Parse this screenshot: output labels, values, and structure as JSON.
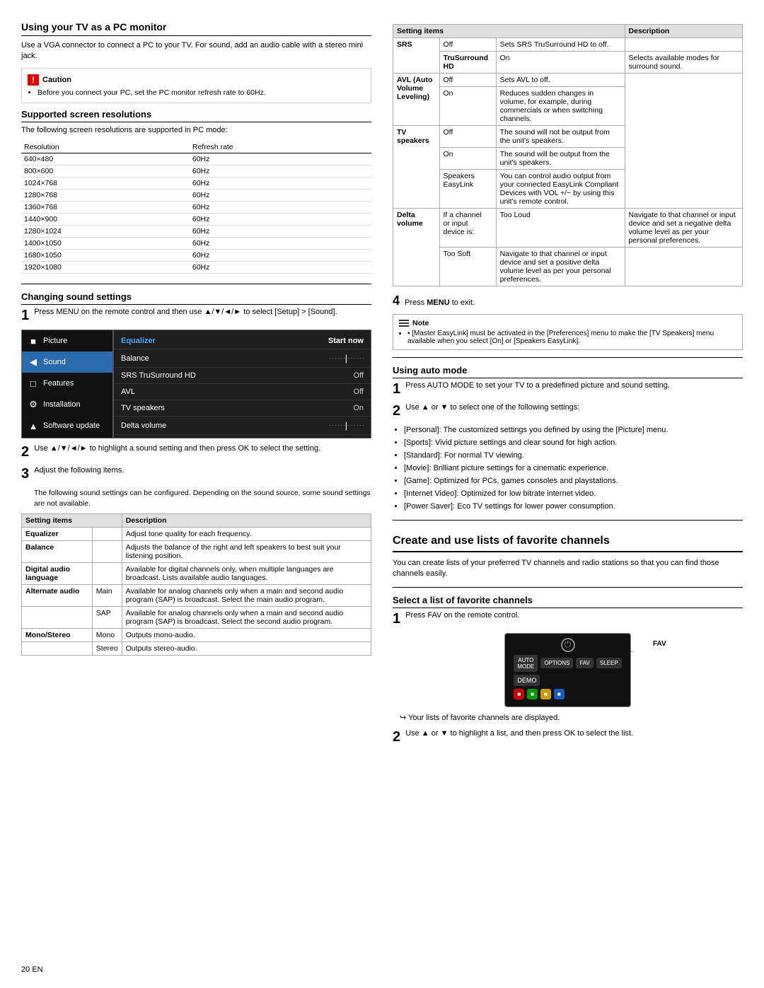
{
  "page": {
    "number": "20",
    "language": "EN"
  },
  "left": {
    "pc_monitor": {
      "title": "Using your TV as a PC monitor",
      "description": "Use a VGA connector to connect a PC to your TV. For sound, add an audio cable with a stereo mini jack.",
      "caution": {
        "label": "Caution",
        "items": [
          "Before you connect your PC, set the PC monitor refresh rate to 60Hz."
        ]
      },
      "screen_resolutions": {
        "title": "Supported screen resolutions",
        "description": "The following screen resolutions are supported in PC mode:",
        "columns": [
          "Resolution",
          "Refresh rate"
        ],
        "rows": [
          [
            "640×480",
            "60Hz"
          ],
          [
            "800×600",
            "60Hz"
          ],
          [
            "1024×768",
            "60Hz"
          ],
          [
            "1280×768",
            "60Hz"
          ],
          [
            "1360×768",
            "60Hz"
          ],
          [
            "1440×900",
            "60Hz"
          ],
          [
            "1280×1024",
            "60Hz"
          ],
          [
            "1400×1050",
            "60Hz"
          ],
          [
            "1680×1050",
            "60Hz"
          ],
          [
            "1920×1080",
            "60Hz"
          ]
        ]
      }
    },
    "sound_settings": {
      "title": "Changing sound settings",
      "step1_text": "Press MENU on the remote control and then use ▲/▼/◄/► to select [Setup] > [Sound].",
      "menu": {
        "sidebar_items": [
          {
            "label": "Picture",
            "icon": "■",
            "active": false
          },
          {
            "label": "Sound",
            "icon": "◀",
            "active": true
          },
          {
            "label": "Features",
            "icon": "□",
            "active": false
          },
          {
            "label": "Installation",
            "icon": "⚙",
            "active": false
          },
          {
            "label": "Software update",
            "icon": "▲",
            "active": false
          }
        ],
        "content_rows": [
          {
            "label": "Equalizer",
            "value": "Start now",
            "highlight": true
          },
          {
            "label": "Balance",
            "value": "dots_bar",
            "highlight": false
          },
          {
            "label": "SRS TruSurround HD",
            "value": "Off",
            "highlight": false
          },
          {
            "label": "AVL",
            "value": "Off",
            "highlight": false
          },
          {
            "label": "TV speakers",
            "value": "On",
            "highlight": false
          },
          {
            "label": "Delta volume",
            "value": "dots_bar",
            "highlight": false
          }
        ]
      },
      "step2_text": "Use ▲/▼/◄/► to highlight a sound setting and then press OK to select the setting.",
      "step3_text": "Adjust the following items.",
      "step3_note": "The following sound settings can be configured. Depending on the sound source, some sound settings are not available.",
      "settings_table": {
        "columns": [
          "Setting items",
          "Description"
        ],
        "rows": [
          {
            "item": "Equalizer",
            "sub": "",
            "description": "Adjust tone quality for each frequency."
          },
          {
            "item": "Balance",
            "sub": "",
            "description": "Adjusts the balance of the right and left speakers to best suit your listening position."
          },
          {
            "item": "Digital audio language",
            "sub": "",
            "description": "Available for digital channels only, when multiple languages are broadcast. Lists available audio languages."
          },
          {
            "item": "Alternate audio",
            "sub": "Main",
            "description": "Available for analog channels only when a main and second audio program (SAP) is broadcast. Select the main audio program."
          },
          {
            "item": "",
            "sub": "SAP",
            "description": "Available for analog channels only when a main and second audio program (SAP) is broadcast. Select the second audio program."
          },
          {
            "item": "Mono/Stereo",
            "sub": "Mono",
            "description": "Outputs mono-audio."
          },
          {
            "item": "",
            "sub": "Stereo",
            "description": "Outputs stereo-audio."
          }
        ]
      }
    }
  },
  "right": {
    "sound_table": {
      "columns": [
        "Setting items",
        "Description"
      ],
      "rows": [
        {
          "item": "SRS",
          "sub_item": "",
          "sub2": "Off",
          "description": "Sets SRS TruSurround HD to off."
        },
        {
          "item": "TruSurround HD",
          "sub_item": "",
          "sub2": "On",
          "description": "Selects available modes for surround sound."
        },
        {
          "item": "AVL (Auto Volume Leveling)",
          "sub_item": "",
          "sub2": "Off",
          "description": "Sets AVL to off."
        },
        {
          "item": "",
          "sub_item": "",
          "sub2": "On",
          "description": "Reduces sudden changes in volume, for example, during commercials or when switching channels."
        },
        {
          "item": "TV speakers",
          "sub_item": "",
          "sub2": "Off",
          "description": "The sound will not be output from the unit's speakers."
        },
        {
          "item": "",
          "sub_item": "",
          "sub2": "On",
          "description": "The sound will be output from the unit's speakers."
        },
        {
          "item": "",
          "sub_item": "",
          "sub2": "Speakers EasyLink",
          "description": "You can control audio output from your connected EasyLink Compliant Devices with VOL +/− by using this unit's remote control."
        },
        {
          "item": "Delta volume",
          "sub_item": "If a channel or input device is:",
          "sub2": "Too Loud",
          "description": "Navigate to that channel or input device and set a negative delta volume level as per your personal preferences."
        },
        {
          "item": "",
          "sub_item": "",
          "sub2": "Too Soft",
          "description": "Navigate to that channel or input device and set a positive delta volume level as per your personal preferences."
        }
      ]
    },
    "press_menu": "Press MENU to exit.",
    "note": {
      "label": "Note",
      "items": [
        "[Master EasyLink] must be activated in the [Preferences] menu to make the [TV Speakers] menu available when you select [On] or [Speakers EasyLink]."
      ]
    },
    "auto_mode": {
      "title": "Using auto mode",
      "step1": "Press AUTO MODE to set your TV to a predefined picture and sound setting.",
      "step2": "Use ▲ or ▼ to select one of the following settings:",
      "settings": [
        "[Personal]: The customized settings you defined by using the [Picture] menu.",
        "[Sports]: Vivid picture settings and clear sound for high action.",
        "[Standard]: For normal TV viewing.",
        "[Movie]: Brilliant picture settings for a cinematic experience.",
        "[Game]: Optimized for PCs, games consoles and playstations.",
        "[Internet Video]: Optimized for low bitrate internet video.",
        "[Power Saver]: Eco TV settings for lower power consumption."
      ]
    },
    "favorite_channels": {
      "title": "Create and use lists of favorite channels",
      "description": "You can create lists of your preferred TV channels and radio stations so that you can find those channels easily.",
      "select_list": {
        "title": "Select a list of favorite channels",
        "step1": "Press FAV on the remote control.",
        "arrow_note": "Your lists of favorite channels are displayed.",
        "step2": "Use ▲ or ▼ to highlight a list, and then press OK to select the list.",
        "remote_buttons": {
          "power_symbol": "⏻",
          "row1": [
            "AUTO MODE",
            "OPTIONS",
            "FAV",
            "SLEEP"
          ],
          "row2_colors": [
            "red",
            "green",
            "yellow",
            "blue"
          ],
          "fav_label": "FAV"
        }
      }
    }
  }
}
